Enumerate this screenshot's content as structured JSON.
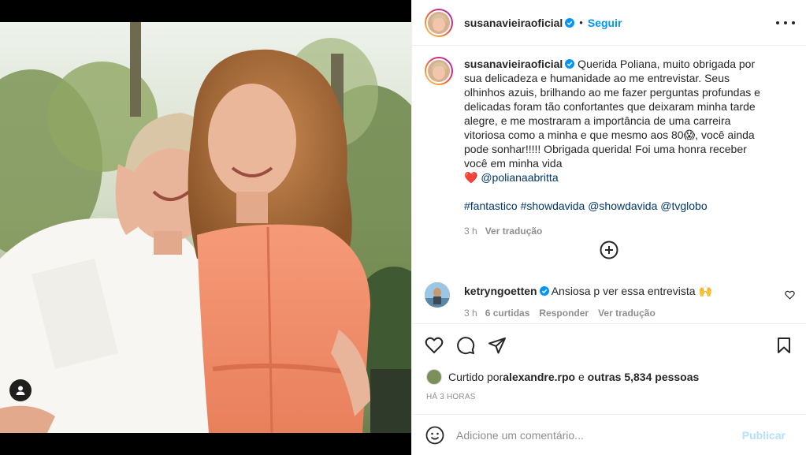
{
  "post": {
    "author": "susanavieiraoficial",
    "follow_label": "Seguir",
    "dot": "•",
    "caption_line1": " Querida Poliana, muito obrigada por sua delicadeza e humanidade ao me entrevistar. Seus olhinhos azuis, brilhando ao me fazer perguntas profundas e delicadas foram tão confortantes que deixaram minha tarde alegre, e me mostraram a importância de uma carreira vitoriosa como a minha e que mesmo aos 80😱, você ainda pode sonhar!!!!! Obrigada querida! Foi uma honra receber você em minha vida",
    "caption_heart": "❤️",
    "caption_mention": "@polianaabritta",
    "hashtags": "#fantastico #showdavida @showdavida @tvglobo",
    "caption_time": "3 h",
    "see_translation": "Ver tradução"
  },
  "comment": {
    "author": "ketryngoetten",
    "text": " Ansiosa p ver essa entrevista 🙌",
    "time": "3 h",
    "likes": "6 curtidas",
    "reply": "Responder",
    "see_translation": "Ver tradução"
  },
  "likes": {
    "prefix": "Curtido por ",
    "first_user": "alexandre.rpo",
    "connector": " e ",
    "others": "outras 5,834 pessoas"
  },
  "timestamp": "HÁ 3 HORAS",
  "comment_box": {
    "placeholder": "Adicione um comentário...",
    "publish_label": "Publicar"
  },
  "icons": {
    "heart": "heart-icon",
    "comment": "comment-icon",
    "share": "share-icon",
    "save": "bookmark-icon",
    "emoji": "emoji-icon",
    "more": "more-icon",
    "add": "plus-circle-icon",
    "tag": "user-tag-icon"
  },
  "colors": {
    "accent": "#0095f6",
    "link": "#00376b",
    "verified": "#0095f6",
    "publish_disabled": "#b2dffc"
  }
}
